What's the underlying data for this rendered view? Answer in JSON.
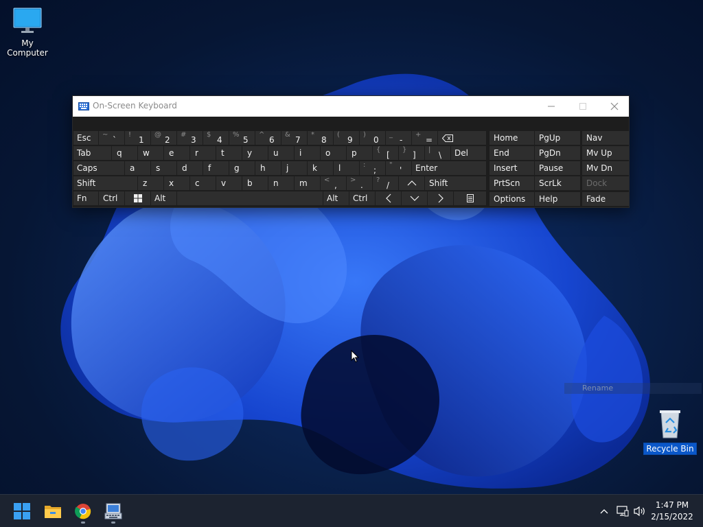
{
  "desktop": {
    "icons": [
      {
        "label": "My Computer"
      },
      {
        "label": "Recycle Bin"
      }
    ],
    "rename_hint": "Rename"
  },
  "osk": {
    "title": "On-Screen Keyboard",
    "row1": [
      {
        "label": "Esc"
      },
      {
        "shift": "~",
        "base": "`"
      },
      {
        "shift": "!",
        "base": "1"
      },
      {
        "shift": "@",
        "base": "2"
      },
      {
        "shift": "#",
        "base": "3"
      },
      {
        "shift": "$",
        "base": "4"
      },
      {
        "shift": "%",
        "base": "5"
      },
      {
        "shift": "^",
        "base": "6"
      },
      {
        "shift": "&",
        "base": "7"
      },
      {
        "shift": "*",
        "base": "8"
      },
      {
        "shift": "(",
        "base": "9"
      },
      {
        "shift": ")",
        "base": "0"
      },
      {
        "shift": "_",
        "base": "-"
      },
      {
        "shift": "+",
        "base": "="
      }
    ],
    "row2": [
      {
        "label": "Tab"
      },
      {
        "label": "q"
      },
      {
        "label": "w"
      },
      {
        "label": "e"
      },
      {
        "label": "r"
      },
      {
        "label": "t"
      },
      {
        "label": "y"
      },
      {
        "label": "u"
      },
      {
        "label": "i"
      },
      {
        "label": "o"
      },
      {
        "label": "p"
      },
      {
        "shift": "{",
        "base": "["
      },
      {
        "shift": "}",
        "base": "]"
      },
      {
        "shift": "|",
        "base": "\\"
      },
      {
        "label": "Del"
      }
    ],
    "row3": [
      {
        "label": "Caps"
      },
      {
        "label": "a"
      },
      {
        "label": "s"
      },
      {
        "label": "d"
      },
      {
        "label": "f"
      },
      {
        "label": "g"
      },
      {
        "label": "h"
      },
      {
        "label": "j"
      },
      {
        "label": "k"
      },
      {
        "label": "l"
      },
      {
        "shift": ":",
        "base": ";"
      },
      {
        "shift": "\"",
        "base": "'"
      },
      {
        "label": "Enter"
      }
    ],
    "row4": [
      {
        "label": "Shift"
      },
      {
        "label": "z"
      },
      {
        "label": "x"
      },
      {
        "label": "c"
      },
      {
        "label": "v"
      },
      {
        "label": "b"
      },
      {
        "label": "n"
      },
      {
        "label": "m"
      },
      {
        "shift": "<",
        "base": ","
      },
      {
        "shift": ">",
        "base": "."
      },
      {
        "shift": "?",
        "base": "/"
      },
      {
        "label": "Shift"
      }
    ],
    "row5": [
      {
        "label": "Fn"
      },
      {
        "label": "Ctrl"
      },
      {
        "label": "Alt"
      },
      {
        "label": "Alt"
      },
      {
        "label": "Ctrl"
      }
    ],
    "nav": [
      [
        "Home",
        "PgUp",
        "Nav"
      ],
      [
        "End",
        "PgDn",
        "Mv Up"
      ],
      [
        "Insert",
        "Pause",
        "Mv Dn"
      ],
      [
        "PrtScn",
        "ScrLk",
        "Dock"
      ],
      [
        "Options",
        "Help",
        "Fade"
      ]
    ],
    "colors": {
      "key": "#2e2e2e",
      "key_text": "#f2f2f2",
      "dim_text": "#6c6c6c",
      "panel": "#1d1d1d"
    }
  },
  "taskbar": {
    "apps": [
      {
        "icon": "windows-start-icon"
      },
      {
        "icon": "file-explorer-icon"
      },
      {
        "icon": "chrome-icon"
      },
      {
        "icon": "on-screen-keyboard-icon"
      }
    ],
    "tray": {
      "icons": [
        "chevron-up-icon",
        "network-icon",
        "volume-icon"
      ],
      "time": "1:47 PM",
      "date": "2/15/2022"
    }
  }
}
